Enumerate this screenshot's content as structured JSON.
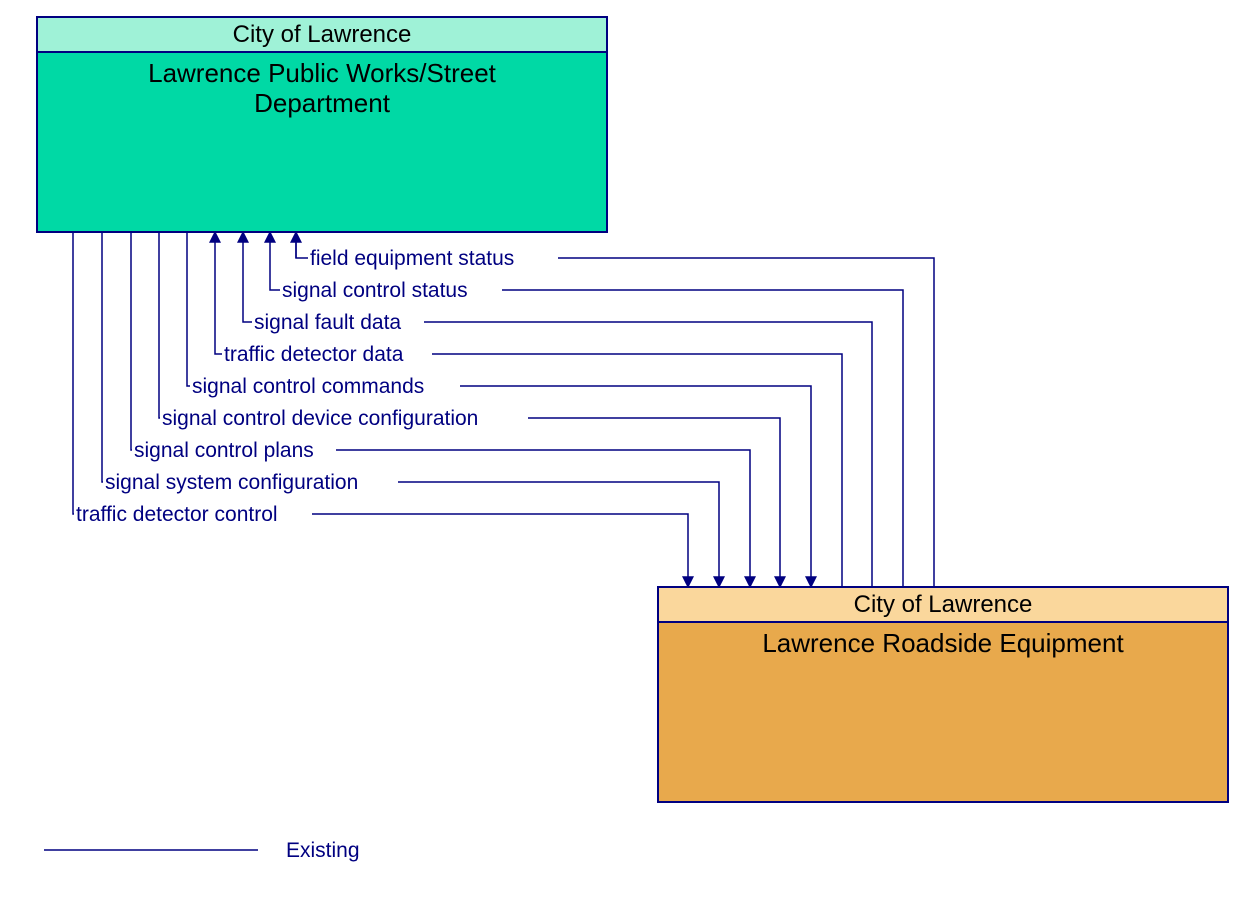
{
  "colors": {
    "line": "#000080",
    "box1_header": "#9FF2D7",
    "box1_body": "#00D9A5",
    "box2_header": "#FAD79C",
    "box2_body": "#E8A94C"
  },
  "box1": {
    "header": "City of Lawrence",
    "body_line1": "Lawrence Public Works/Street",
    "body_line2": "Department"
  },
  "box2": {
    "header": "City of Lawrence",
    "body_line1": "Lawrence Roadside Equipment"
  },
  "flows_to_box1": [
    "field equipment status",
    "signal control status",
    "signal fault data",
    "traffic detector data"
  ],
  "flows_to_box2": [
    "signal control commands",
    "signal control device configuration",
    "signal control plans",
    "signal system configuration",
    "traffic detector control"
  ],
  "legend": {
    "existing": "Existing"
  }
}
